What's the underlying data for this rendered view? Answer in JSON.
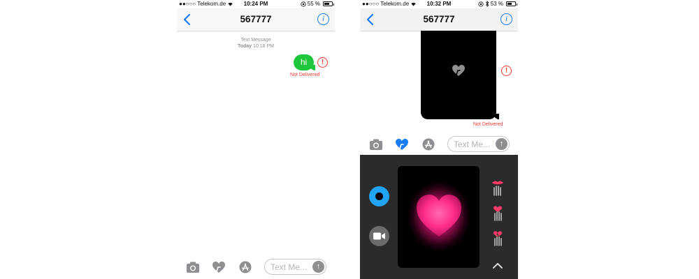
{
  "screens": [
    {
      "status": {
        "carrier": "●●○○○ Telekom.de",
        "time": "10:24 PM",
        "battery": "55 %",
        "battery_level": 0.55
      },
      "nav": {
        "title": "567777"
      },
      "conversation": {
        "service": "Text Message",
        "day": "Today",
        "time": "10:18 PM"
      },
      "message": {
        "text": "hi",
        "status": "Not Delivered"
      },
      "input": {
        "placeholder": "Text Me..."
      }
    },
    {
      "status": {
        "carrier": "●●○○○ Telekom.de",
        "time": "10:32 PM",
        "battery": "53 %",
        "battery_level": 0.53
      },
      "nav": {
        "title": "567777"
      },
      "message": {
        "status": "Not Delivered"
      },
      "input": {
        "placeholder": "Text Me..."
      },
      "digital_touch": {
        "effect_color": "#ff2d8a",
        "record_color": "#20a4f3",
        "gestures": [
          "kiss-gesture-icon",
          "heartbeat-gesture-icon",
          "heartbreak-gesture-icon"
        ]
      }
    }
  ],
  "colors": {
    "accent": "#1a7cf5",
    "sms_bubble": "#1fc63c",
    "error": "#ff3b30"
  },
  "icons": [
    "wifi-icon",
    "location-icon",
    "bluetooth-icon",
    "back-chevron-icon",
    "info-icon",
    "camera-icon",
    "digital-touch-heart-icon",
    "app-store-icon",
    "send-arrow-icon",
    "error-alert-icon",
    "video-camera-icon",
    "chevron-up-icon"
  ]
}
